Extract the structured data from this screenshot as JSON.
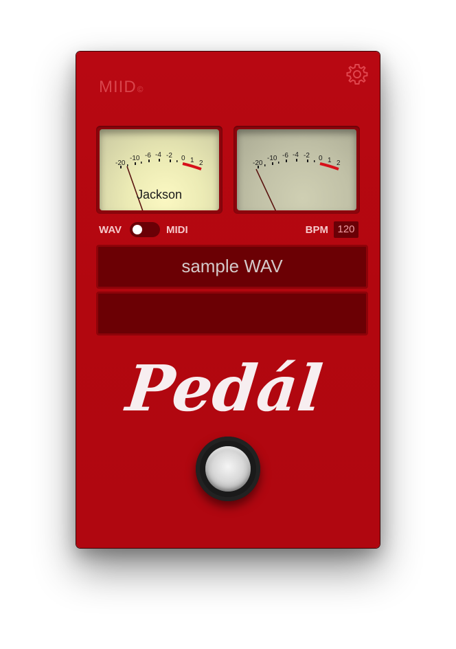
{
  "brand": {
    "name": "MIID",
    "mark": "©"
  },
  "settings": {
    "icon": "gear-icon"
  },
  "meters": {
    "scale": [
      "-20",
      "-10",
      "-6",
      "-4",
      "-2",
      "0",
      "1",
      "2"
    ],
    "left": {
      "label": "Jackson"
    },
    "right": {
      "label": ""
    }
  },
  "mode": {
    "left_label": "WAV",
    "right_label": "MIDI",
    "selected": "WAV"
  },
  "tempo": {
    "label": "BPM",
    "value": "120"
  },
  "display": {
    "line1": "sample WAV",
    "line2": ""
  },
  "logo": {
    "text": "Pedál"
  },
  "footswitch": {
    "icon": "footswitch-icon"
  },
  "colors": {
    "body": "#b2070f",
    "display": "#6b0004",
    "accent": "#d7101a"
  }
}
